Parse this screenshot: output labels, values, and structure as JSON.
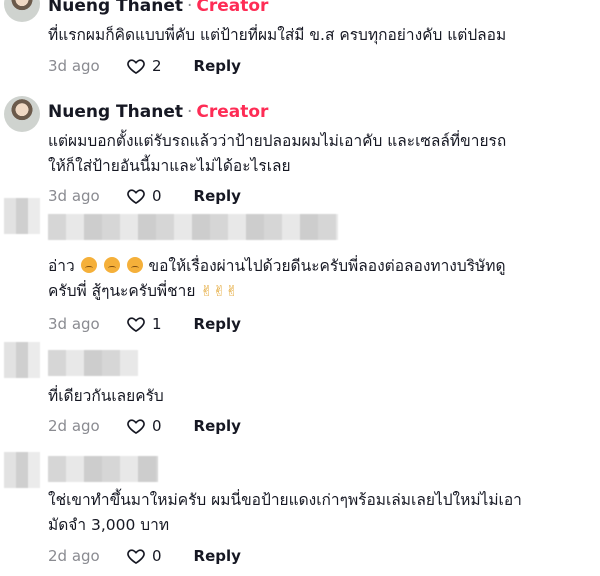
{
  "comments": [
    {
      "username": "Nueng Thanet",
      "separator": "·",
      "badge": "Creator",
      "text": "ที่แรกผมก็คิดแบบพี่คับ แต่ป้ายที่ผมใส่มี ข.ส ครบทุกอย่างคับ แต่ปลอม",
      "date": "3d ago",
      "likes": "2",
      "reply": "Reply"
    },
    {
      "username": "Nueng Thanet",
      "separator": "·",
      "badge": "Creator",
      "text_line1": "แต่ผมบอกตั้งแต่รับรถแล้วว่าป้ายปลอมผมไม่เอาคับ และเซลล์ที่ขายรถ",
      "text_line2": "ให้ก็ใส่ป้ายอันนี้มาและไม่ได้อะไรเลย",
      "date": "3d ago",
      "likes": "0",
      "reply": "Reply"
    },
    {
      "text_start": "อ่าว",
      "text_mid": " ขอให้เรื่องผ่านไปด้วยดีนะครับพี่ลองต่อลองทางบริษัทดู",
      "text_line2": "ครับพี่ สู้ๆนะครับพี่ชาย",
      "hands": "✌✌✌",
      "date": "3d ago",
      "likes": "1",
      "reply": "Reply"
    },
    {
      "text": "ที่เดียวกันเลยครับ",
      "date": "2d ago",
      "likes": "0",
      "reply": "Reply"
    },
    {
      "text_line1": "ใช่เขาทำขึ้นมาใหม่ครับ ผมนี่ขอป้ายแดงเก่าๆพร้อมเล่มเลยไปใหม่ไม่เอา",
      "text_line2": "มัดจำ 3,000 บาท",
      "date": "2d ago",
      "likes": "0",
      "reply": "Reply"
    }
  ],
  "icons": {
    "like": "heart-outline-icon"
  },
  "colors": {
    "creator": "#fe2c55",
    "meta_gray": "#8a8b91"
  }
}
